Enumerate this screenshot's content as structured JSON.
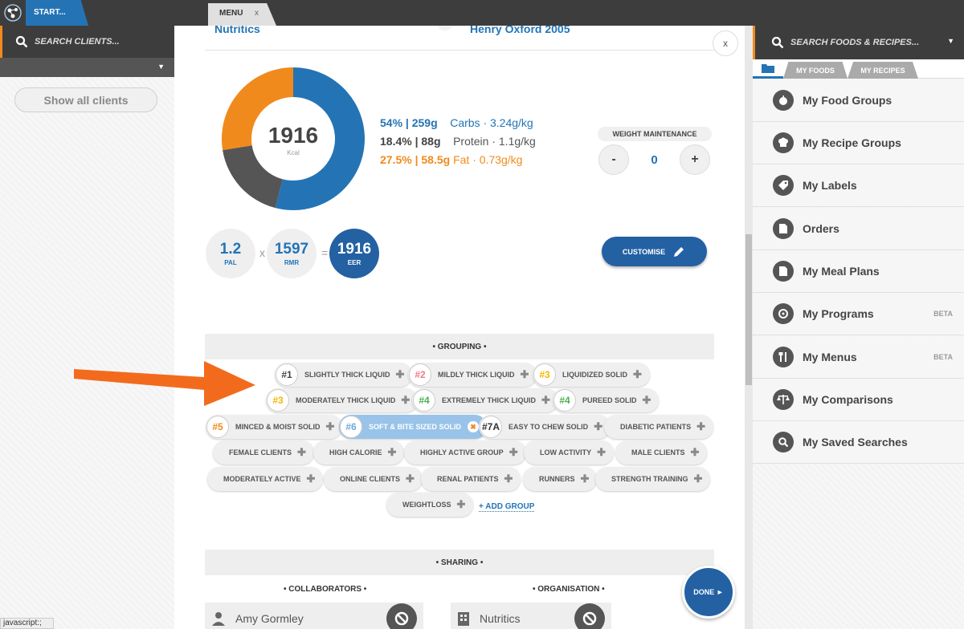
{
  "topbar": {
    "start_label": "START...",
    "menu_tab_label": "MENU",
    "menu_tab_close": "x"
  },
  "left": {
    "search_placeholder": "SEARCH CLIENTS...",
    "show_all_label": "Show all clients"
  },
  "header": {
    "left_title": "Nutritics",
    "right_title": "Henry Oxford 2005",
    "close": "x"
  },
  "energy": {
    "kcal": "1916",
    "unit": "Kcal",
    "macros": [
      {
        "value": "54% | 259g",
        "label": "Carbs · 3.24g/kg",
        "color": "#2474b5",
        "label_color": "#2474b5",
        "pct": 54
      },
      {
        "value": "18.4% | 88g",
        "label": "Protein · 1.1g/kg",
        "color": "#444444",
        "label_color": "#555555",
        "pct": 18.4
      },
      {
        "value": "27.5% | 58.5g",
        "label": "Fat · 0.73g/kg",
        "color": "#f18a1d",
        "label_color": "#f18a1d",
        "pct": 27.5
      }
    ],
    "weight_label": "WEIGHT MAINTENANCE",
    "minus": "-",
    "plus": "+",
    "weight_value": "0",
    "pal_value": "1.2",
    "pal_label": "PAL",
    "times": "x",
    "rmr_value": "1597",
    "rmr_label": "RMR",
    "equals": "=",
    "eer_value": "1916",
    "eer_label": "EER",
    "customise_label": "CUSTOMISE"
  },
  "grouping": {
    "title": "• GROUPING •",
    "tags": [
      {
        "num": "#1",
        "num_color": "#444444",
        "label": "SLIGHTLY THICK LIQUID"
      },
      {
        "num": "#2",
        "num_color": "#f07a8a",
        "label": "MILDLY THICK LIQUID"
      },
      {
        "num": "#3",
        "num_color": "#f5b800",
        "label": "LIQUIDIZED SOLID"
      },
      {
        "num": "#3",
        "num_color": "#f5b800",
        "label": "MODERATELY THICK LIQUID"
      },
      {
        "num": "#4",
        "num_color": "#4caf50",
        "label": "EXTREMELY THICK LIQUID"
      },
      {
        "num": "#4",
        "num_color": "#4caf50",
        "label": "PUREED SOLID"
      },
      {
        "num": "#5",
        "num_color": "#f18a1d",
        "label": "MINCED & MOIST SOLID"
      },
      {
        "num": "#6",
        "num_color": "#6fa8dc",
        "label": "SOFT & BITE SIZED SOLID"
      },
      {
        "num": "#7A",
        "num_color": "#333333",
        "label": "EASY TO CHEW SOLID"
      },
      {
        "label": "DIABETIC PATIENTS"
      },
      {
        "label": "FEMALE CLIENTS"
      },
      {
        "label": "HIGH CALORIE"
      },
      {
        "label": "HIGHLY ACTIVE GROUP"
      },
      {
        "label": "LOW ACTIVITY"
      },
      {
        "label": "MALE CLIENTS"
      },
      {
        "label": "MODERATELY ACTIVE"
      },
      {
        "label": "ONLINE CLIENTS"
      },
      {
        "label": "RENAL PATIENTS"
      },
      {
        "label": "RUNNERS"
      },
      {
        "label": "STRENGTH TRAINING"
      },
      {
        "label": "WEIGHTLOSS"
      }
    ],
    "add_group": "+ ADD GROUP"
  },
  "sharing": {
    "title": "• SHARING •",
    "collaborators_title": "• COLLABORATORS •",
    "organisation_title": "• ORGANISATION •",
    "collaborator": "Amy Gormley",
    "organisation": "Nutritics"
  },
  "done_label": "DONE ►",
  "right": {
    "search_placeholder": "SEARCH FOODS & RECIPES...",
    "tabs": [
      "MY FOODS",
      "MY RECIPES"
    ],
    "items": [
      {
        "label": "My Food Groups",
        "icon": "apple-icon"
      },
      {
        "label": "My Recipe Groups",
        "icon": "chef-hat-icon"
      },
      {
        "label": "My Labels",
        "icon": "tag-icon"
      },
      {
        "label": "Orders",
        "icon": "document-icon"
      },
      {
        "label": "My Meal Plans",
        "icon": "document-icon"
      },
      {
        "label": "My Programs",
        "icon": "cycle-icon",
        "badge": "BETA"
      },
      {
        "label": "My Menus",
        "icon": "cutlery-icon",
        "badge": "BETA"
      },
      {
        "label": "My Comparisons",
        "icon": "scales-icon"
      },
      {
        "label": "My Saved Searches",
        "icon": "search-icon"
      }
    ]
  },
  "statusbar": "javascript:;",
  "colors": {
    "accent_blue": "#2474b5",
    "dark_blue": "#2361a3",
    "orange": "#f18a1d",
    "dark": "#3d3d3d"
  }
}
